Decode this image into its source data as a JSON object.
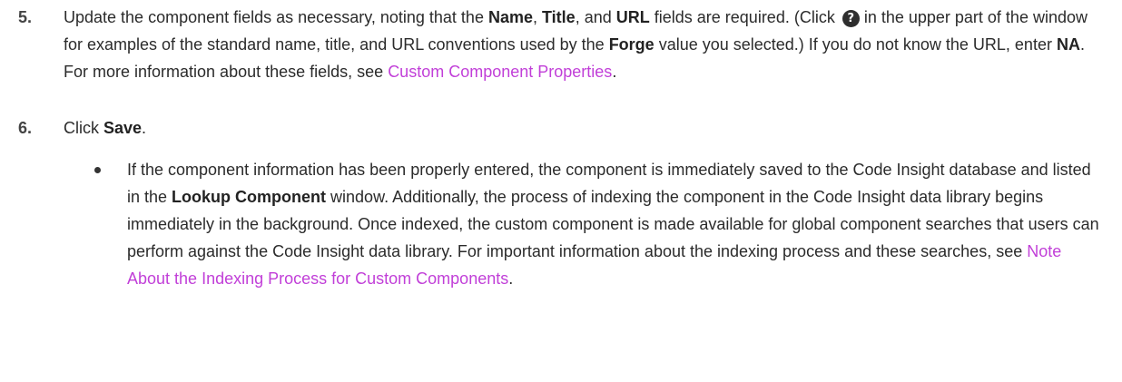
{
  "steps": [
    {
      "number": "5.",
      "t1": "Update the component fields as necessary, noting that the ",
      "b1": "Name",
      "t2": ", ",
      "b2": "Title",
      "t3": ", and ",
      "b3": "URL",
      "t4": " fields are required. (Click ",
      "icon": "help-icon",
      "icon_glyph": "?",
      "t5": " in the upper part of the window for examples of the standard name, title, and URL conventions used by the ",
      "b4": "Forge",
      "t6": " value you selected.) If you do not know the URL, enter ",
      "b5": "NA",
      "t7": ". For more information about these fields, see ",
      "link": "Custom Component Properties",
      "t8": "."
    },
    {
      "number": "6.",
      "t1": "Click ",
      "b1": "Save",
      "t2": "."
    }
  ],
  "bullet": {
    "t1": "If the component information has been properly entered, the component is immediately saved to the Code Insight database and listed in the ",
    "b1": "Lookup Component",
    "t2": " window. Additionally, the process of indexing the component in the Code Insight data library begins immediately in the background. Once indexed, the custom component is made available for global component searches that users can perform against the Code Insight data library. For important information about the indexing process and these searches, see ",
    "link": "Note About the Indexing Process for Custom Components",
    "t3": "."
  },
  "colors": {
    "link": "#c13fd8",
    "text": "#2b2b2b"
  }
}
